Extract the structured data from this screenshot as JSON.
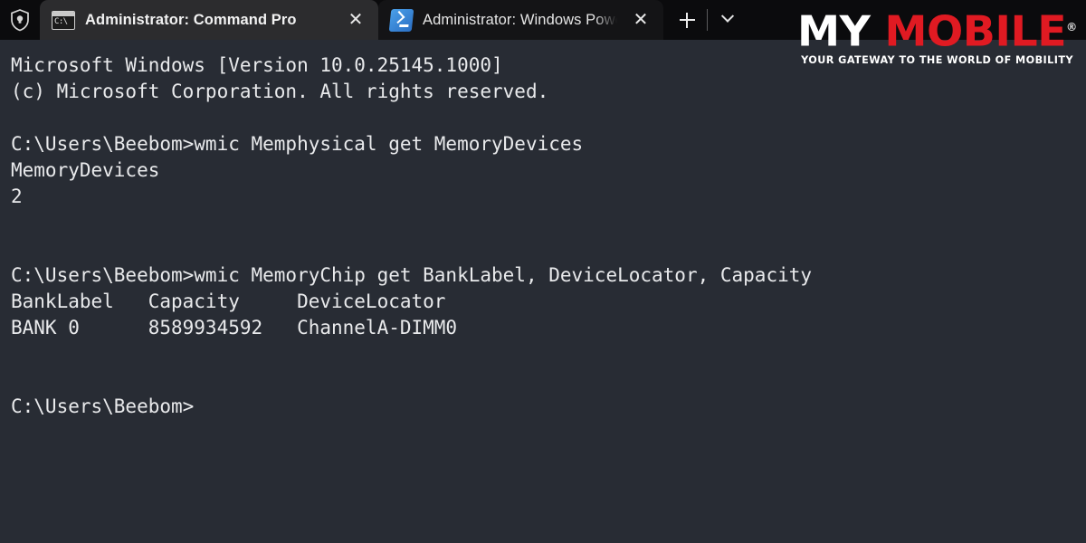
{
  "window": {
    "admin_shield_icon": "shield-icon"
  },
  "tabs": [
    {
      "icon": "cmd-icon",
      "icon_text": "C:\\",
      "label": "Administrator: Command Pro",
      "active": true,
      "close_label": "✕"
    },
    {
      "icon": "powershell-icon",
      "label": "Administrator: Windows Power",
      "active": false,
      "close_label": "✕"
    }
  ],
  "tabbar_actions": {
    "new_tab_label": "+",
    "dropdown_label": "⌄"
  },
  "terminal": {
    "background_color": "#282c34",
    "text_color": "#e9eaec",
    "lines": [
      "Microsoft Windows [Version 10.0.25145.1000]",
      "(c) Microsoft Corporation. All rights reserved.",
      "",
      "C:\\Users\\Beebom>wmic Memphysical get MemoryDevices",
      "MemoryDevices",
      "2",
      "",
      "",
      "C:\\Users\\Beebom>wmic MemoryChip get BankLabel, DeviceLocator, Capacity",
      "BankLabel   Capacity     DeviceLocator",
      "BANK 0      8589934592   ChannelA-DIMM0",
      "",
      "",
      "C:\\Users\\Beebom>"
    ]
  },
  "logo": {
    "word_one": "MY",
    "word_two": "MOBILE",
    "registered_mark": "®",
    "tagline": "YOUR GATEWAY TO THE WORLD OF MOBILITY",
    "color_white": "#ffffff",
    "color_red": "#e01a22"
  }
}
